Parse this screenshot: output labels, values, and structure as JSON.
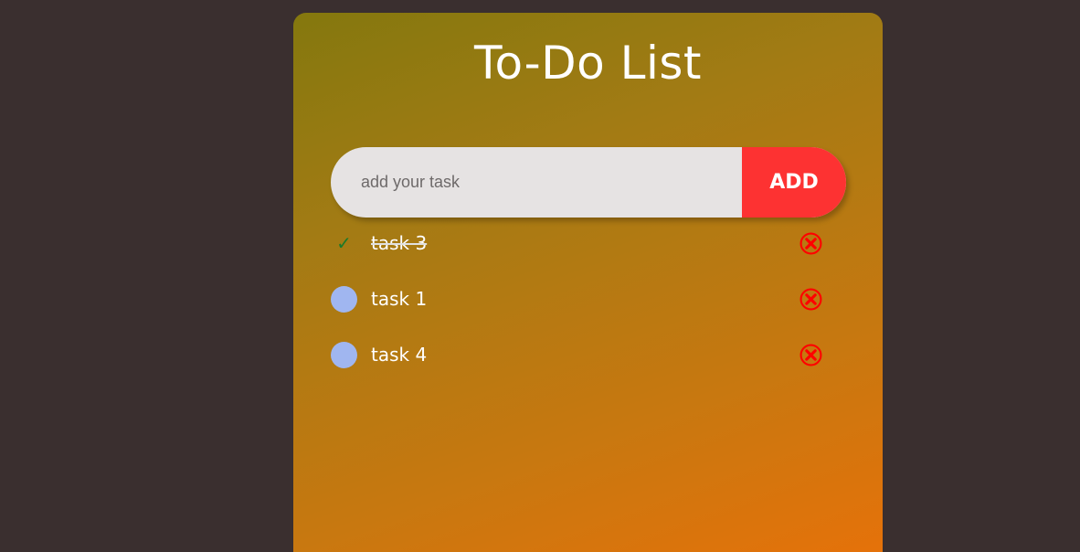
{
  "app": {
    "title": "To-Do List"
  },
  "input": {
    "placeholder": "add your task",
    "value": ""
  },
  "add_button": {
    "label": "ADD"
  },
  "tasks": [
    {
      "text": "task 3",
      "completed": true
    },
    {
      "text": "task 1",
      "completed": false
    },
    {
      "text": "task 4",
      "completed": false
    }
  ],
  "icons": {
    "check": "checkmark-icon",
    "delete": "close-circle-icon",
    "uncheck": "circle-icon"
  },
  "colors": {
    "background": "#3a2f2f",
    "add_button": "#fd3232",
    "unchecked_circle": "#a0b6f0",
    "checkmark": "#1a7a2a",
    "delete_icon": "#ff0000"
  }
}
